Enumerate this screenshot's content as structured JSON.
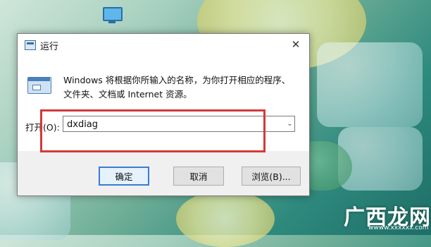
{
  "dialog": {
    "title": "运行",
    "description_line1": "Windows 将根据你所输入的名称，为你打开相应的程序、",
    "description_line2": "文件夹、文档或 Internet 资源。",
    "open_label": "打开(O):",
    "input_value": "dxdiag",
    "buttons": {
      "ok": "确定",
      "cancel": "取消",
      "browse": "浏览(B)..."
    },
    "close_glyph": "✕",
    "dropdown_glyph": "⌄"
  },
  "watermark": {
    "text": "广西龙网",
    "url": "wwww.xxxxxx.com"
  },
  "colors": {
    "highlight": "#d23a3a",
    "ok_border": "#3a7bd5"
  }
}
